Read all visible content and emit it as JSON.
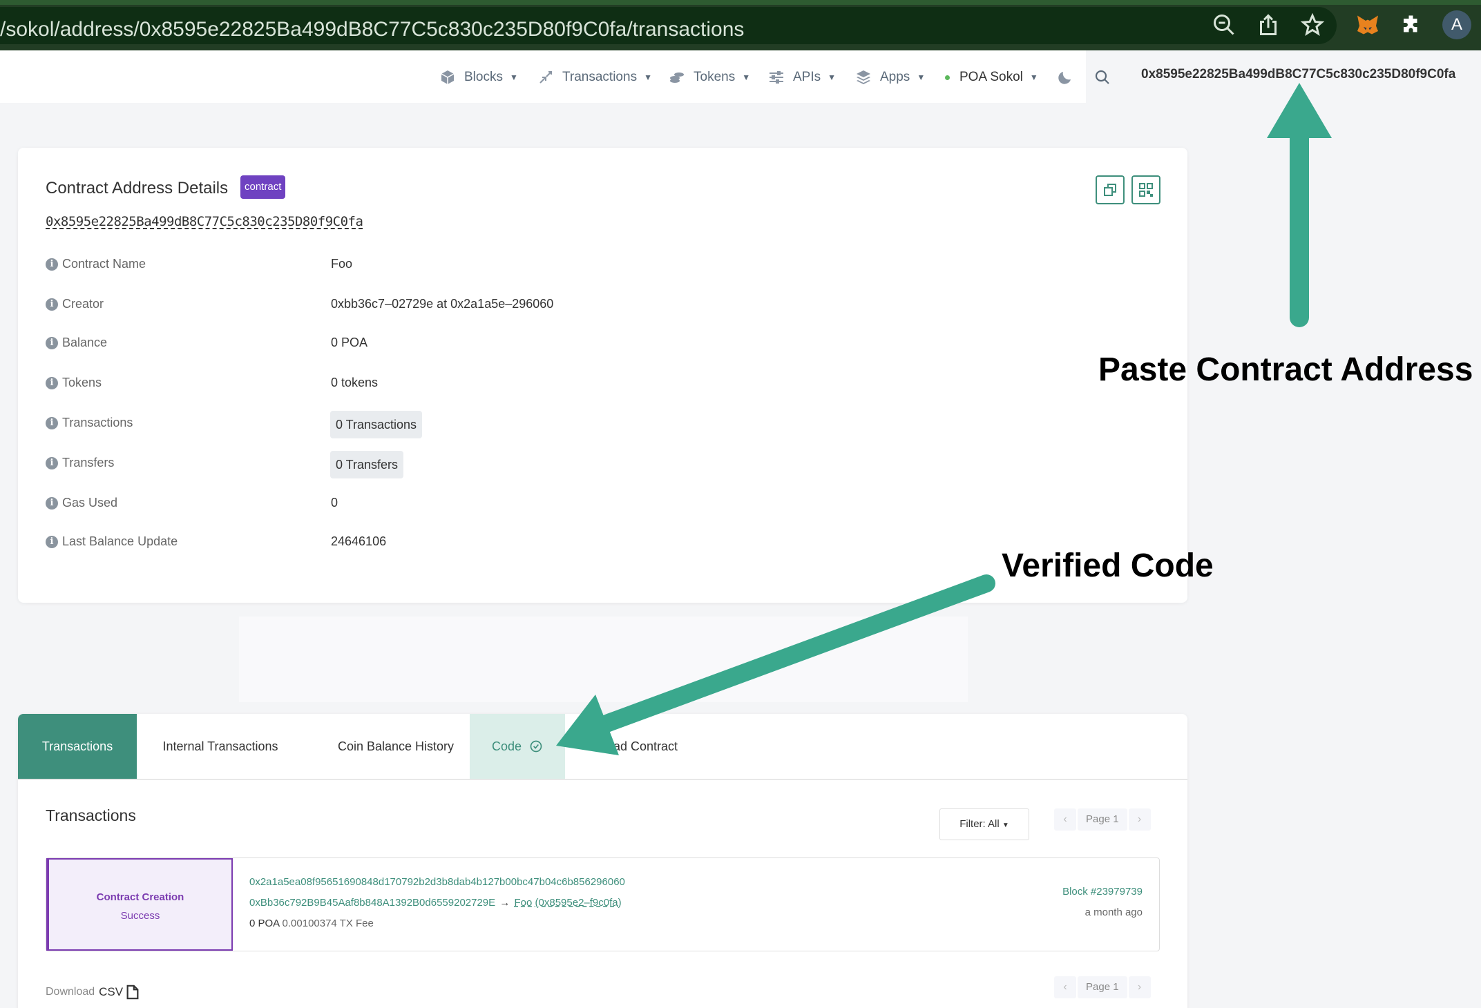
{
  "browser": {
    "url": "/sokol/address/0x8595e22825Ba499dB8C77C5c830c235D80f9C0fa/transactions",
    "avatar_letter": "A",
    "icons": [
      "zoom-out-icon",
      "share-icon",
      "star-icon",
      "metamask-fox-icon",
      "extensions-icon"
    ]
  },
  "navbar": {
    "items": [
      {
        "label": "Blocks",
        "icon": "cube-icon"
      },
      {
        "label": "Transactions",
        "icon": "transactions-icon"
      },
      {
        "label": "Tokens",
        "icon": "coins-icon"
      },
      {
        "label": "APIs",
        "icon": "sliders-icon"
      },
      {
        "label": "Apps",
        "icon": "layers-icon"
      },
      {
        "label": "POA Sokol",
        "icon": "status-dot"
      }
    ],
    "search_value": "0x8595e22825Ba499dB8C77C5c830c235D80f9C0fa",
    "accent": "#3e8f7c"
  },
  "details": {
    "title": "Contract Address Details",
    "badge": "contract",
    "address": "0x8595e22825Ba499dB8C77C5c830c235D80f9C0fa",
    "rows": [
      {
        "label": "Contract Name",
        "value": "Foo"
      },
      {
        "label": "Creator",
        "value": "0xbb36c7–02729e at 0x2a1a5e–296060"
      },
      {
        "label": "Balance",
        "value": "0 POA"
      },
      {
        "label": "Tokens",
        "value": "0 tokens"
      },
      {
        "label": "Transactions",
        "value": "0 Transactions"
      },
      {
        "label": "Transfers",
        "value": "0 Transfers"
      },
      {
        "label": "Gas Used",
        "value": "0"
      },
      {
        "label": "Last Balance Update",
        "value": "24646106"
      }
    ]
  },
  "tabs": {
    "items": [
      "Transactions",
      "Internal Transactions",
      "Coin Balance History",
      "Code",
      "Read Contract"
    ],
    "active": "Transactions"
  },
  "transactions": {
    "title": "Transactions",
    "filter_label": "Filter: All",
    "page_label": "Page 1",
    "row": {
      "type": "Contract Creation",
      "status": "Success",
      "hash": "0x2a1a5ea08f95651690848d170792b2d3b8dab4b127b00bc47b04c6b856296060",
      "from": "0xBb36c792B9B45Aaf8b848A1392B0d6559202729E",
      "arrow": "→",
      "to": "Foo (0x8595e2–f9c0fa)",
      "value": "0 POA",
      "fee": "0.00100374 TX Fee",
      "block": "Block #23979739",
      "age": "a month ago"
    },
    "download_label": "Download",
    "download_csv": "CSV"
  },
  "annotations": {
    "paste": "Paste Contract Address",
    "verified": "Verified Code",
    "arrow_color": "#3aa88d"
  }
}
